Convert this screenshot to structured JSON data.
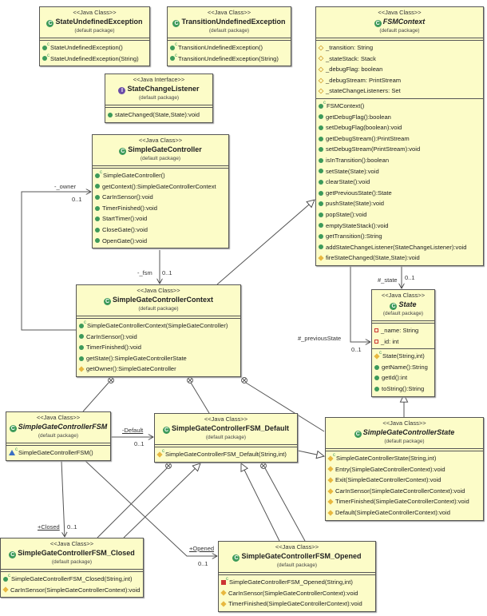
{
  "diagram": {
    "classes": [
      {
        "id": "StateUndefinedException",
        "stereotype": "<<Java Class>>",
        "name": "StateUndefinedException",
        "kind": "class",
        "abstract": false,
        "package": "(default package)",
        "fields": [],
        "methods": [
          {
            "icon": "constructor",
            "text": "StateUndefinedException()"
          },
          {
            "icon": "constructor",
            "text": "StateUndefinedException(String)"
          }
        ]
      },
      {
        "id": "TransitionUndefinedException",
        "stereotype": "<<Java Class>>",
        "name": "TransitionUndefinedException",
        "kind": "class",
        "abstract": false,
        "package": "(default package)",
        "fields": [],
        "methods": [
          {
            "icon": "constructor",
            "text": "TransitionUndefinedException()"
          },
          {
            "icon": "constructor",
            "text": "TransitionUndefinedException(String)"
          }
        ]
      },
      {
        "id": "StateChangeListener",
        "stereotype": "<<Java Interface>>",
        "name": "StateChangeListener",
        "kind": "interface",
        "abstract": false,
        "package": "(default package)",
        "fields": [],
        "methods": [
          {
            "icon": "public",
            "text": "stateChanged(State,State):void"
          }
        ]
      },
      {
        "id": "FSMContext",
        "stereotype": "<<Java Class>>",
        "name": "FSMContext",
        "kind": "class",
        "abstract": true,
        "package": "(default package)",
        "fields": [
          {
            "icon": "field-protected",
            "text": "_transition: String"
          },
          {
            "icon": "field-protected",
            "text": "_stateStack: Stack"
          },
          {
            "icon": "field-protected",
            "text": "_debugFlag: boolean"
          },
          {
            "icon": "field-protected",
            "text": "_debugStream: PrintStream"
          },
          {
            "icon": "field-protected",
            "text": "_stateChangeListeners: Set"
          }
        ],
        "methods": [
          {
            "icon": "constructor",
            "text": "FSMContext()"
          },
          {
            "icon": "public",
            "text": "getDebugFlag():boolean"
          },
          {
            "icon": "public",
            "text": "setDebugFlag(boolean):void"
          },
          {
            "icon": "public",
            "text": "getDebugStream():PrintStream"
          },
          {
            "icon": "public",
            "text": "setDebugStream(PrintStream):void"
          },
          {
            "icon": "public",
            "text": "isInTransition():boolean"
          },
          {
            "icon": "public",
            "text": "setState(State):void"
          },
          {
            "icon": "public",
            "text": "clearState():void"
          },
          {
            "icon": "public",
            "text": "getPreviousState():State"
          },
          {
            "icon": "public",
            "text": "pushState(State):void"
          },
          {
            "icon": "public",
            "text": "popState():void"
          },
          {
            "icon": "public",
            "text": "emptyStateStack():void"
          },
          {
            "icon": "public",
            "text": "getTransition():String"
          },
          {
            "icon": "public",
            "text": "addStateChangeListener(StateChangeListener):void"
          },
          {
            "icon": "protected",
            "text": "fireStateChanged(State,State):void"
          }
        ]
      },
      {
        "id": "SimpleGateController",
        "stereotype": "<<Java Class>>",
        "name": "SimpleGateController",
        "kind": "class",
        "abstract": false,
        "package": "(default package)",
        "fields": [],
        "methods": [
          {
            "icon": "constructor",
            "text": "SimpleGateController()"
          },
          {
            "icon": "public",
            "text": "getContext():SimpleGateControllerContext"
          },
          {
            "icon": "public",
            "text": "CarInSensor():void"
          },
          {
            "icon": "public",
            "text": "TimerFinished():void"
          },
          {
            "icon": "public",
            "text": "StartTimer():void"
          },
          {
            "icon": "public",
            "text": "CloseGate():void"
          },
          {
            "icon": "public",
            "text": "OpenGate():void"
          }
        ]
      },
      {
        "id": "SimpleGateControllerContext",
        "stereotype": "<<Java Class>>",
        "name": "SimpleGateControllerContext",
        "kind": "class",
        "abstract": false,
        "package": "(default package)",
        "fields": [],
        "methods": [
          {
            "icon": "constructor",
            "text": "SimpleGateControllerContext(SimpleGateController)"
          },
          {
            "icon": "public",
            "text": "CarInSensor():void"
          },
          {
            "icon": "public",
            "text": "TimerFinished():void"
          },
          {
            "icon": "public",
            "text": "getState():SimpleGateControllerState"
          },
          {
            "icon": "protected",
            "text": "getOwner():SimpleGateController"
          }
        ]
      },
      {
        "id": "State",
        "stereotype": "<<Java Class>>",
        "name": "State",
        "kind": "class",
        "abstract": true,
        "package": "(default package)",
        "fields": [
          {
            "icon": "private-field",
            "text": "_name: String"
          },
          {
            "icon": "private-field",
            "text": "_id: int"
          }
        ],
        "methods": [
          {
            "icon": "constructor-protected",
            "text": "State(String,int)"
          },
          {
            "icon": "public",
            "text": "getName():String"
          },
          {
            "icon": "public",
            "text": "getId():int"
          },
          {
            "icon": "public",
            "text": "toString():String"
          }
        ]
      },
      {
        "id": "SimpleGateControllerFSM",
        "stereotype": "<<Java Class>>",
        "name": "SimpleGateControllerFSM",
        "kind": "class",
        "abstract": true,
        "package": "(default package)",
        "fields": [],
        "methods": [
          {
            "icon": "constructor-package",
            "text": "SimpleGateControllerFSM()"
          }
        ]
      },
      {
        "id": "SimpleGateControllerFSM_Default",
        "stereotype": "<<Java Class>>",
        "name": "SimpleGateControllerFSM_Default",
        "kind": "class",
        "abstract": false,
        "package": "(default package)",
        "fields": [],
        "methods": [
          {
            "icon": "constructor-protected",
            "text": "SimpleGateControllerFSM_Default(String,int)"
          }
        ]
      },
      {
        "id": "SimpleGateControllerState",
        "stereotype": "<<Java Class>>",
        "name": "SimpleGateControllerState",
        "kind": "class",
        "abstract": true,
        "package": "(default package)",
        "fields": [],
        "methods": [
          {
            "icon": "constructor-protected",
            "text": "SimpleGateControllerState(String,int)"
          },
          {
            "icon": "protected",
            "text": "Entry(SimpleGateControllerContext):void"
          },
          {
            "icon": "protected",
            "text": "Exit(SimpleGateControllerContext):void"
          },
          {
            "icon": "protected",
            "text": "CarInSensor(SimpleGateControllerContext):void"
          },
          {
            "icon": "protected",
            "text": "TimerFinished(SimpleGateControllerContext):void"
          },
          {
            "icon": "protected",
            "text": "Default(SimpleGateControllerContext):void"
          }
        ]
      },
      {
        "id": "SimpleGateControllerFSM_Closed",
        "stereotype": "<<Java Class>>",
        "name": "SimpleGateControllerFSM_Closed",
        "kind": "class",
        "abstract": false,
        "package": "(default package)",
        "fields": [],
        "methods": [
          {
            "icon": "constructor",
            "text": "SimpleGateControllerFSM_Closed(String,int)"
          },
          {
            "icon": "protected",
            "text": "CarInSensor(SimpleGateControllerContext):void"
          }
        ]
      },
      {
        "id": "SimpleGateControllerFSM_Opened",
        "stereotype": "<<Java Class>>",
        "name": "SimpleGateControllerFSM_Opened",
        "kind": "class",
        "abstract": false,
        "package": "(default package)",
        "fields": [],
        "methods": [
          {
            "icon": "constructor-private",
            "text": "SimpleGateControllerFSM_Opened(String,int)"
          },
          {
            "icon": "protected",
            "text": "CarInSensor(SimpleGateControllerContext):void"
          },
          {
            "icon": "protected",
            "text": "TimerFinished(SimpleGateControllerContext):void"
          }
        ]
      }
    ],
    "relations": [
      {
        "type": "association",
        "from": "SimpleGateControllerContext",
        "to": "SimpleGateController",
        "role": "-_owner",
        "multiplicity": "0..1"
      },
      {
        "type": "association",
        "from": "SimpleGateController",
        "to": "SimpleGateControllerContext",
        "role": "-_fsm",
        "multiplicity": "0..1"
      },
      {
        "type": "generalization",
        "from": "SimpleGateControllerContext",
        "to": "FSMContext"
      },
      {
        "type": "association",
        "from": "FSMContext",
        "to": "State",
        "role": "#_state",
        "multiplicity": "0..1"
      },
      {
        "type": "association",
        "from": "FSMContext",
        "to": "State",
        "role": "#_previousState",
        "multiplicity": "0..1"
      },
      {
        "type": "generalization",
        "from": "SimpleGateControllerState",
        "to": "State"
      },
      {
        "type": "nesting",
        "from": "SimpleGateControllerContext",
        "to": "SimpleGateControllerFSM"
      },
      {
        "type": "nesting",
        "from": "SimpleGateControllerContext",
        "to": "SimpleGateControllerFSM_Default"
      },
      {
        "type": "nesting",
        "from": "SimpleGateControllerContext",
        "to": "SimpleGateControllerState"
      },
      {
        "type": "association",
        "from": "SimpleGateControllerFSM",
        "to": "SimpleGateControllerFSM_Default",
        "role": "-Default",
        "multiplicity": "0..1"
      },
      {
        "type": "generalization",
        "from": "SimpleGateControllerFSM_Default",
        "to": "SimpleGateControllerState"
      },
      {
        "type": "association",
        "from": "SimpleGateControllerFSM",
        "to": "SimpleGateControllerFSM_Closed",
        "role": "+Closed",
        "multiplicity": "0..1"
      },
      {
        "type": "association",
        "from": "SimpleGateControllerFSM",
        "to": "SimpleGateControllerFSM_Opened",
        "role": "+Opened",
        "multiplicity": "0..1"
      },
      {
        "type": "nesting",
        "from": "SimpleGateControllerFSM_Default",
        "to": "SimpleGateControllerFSM_Closed"
      },
      {
        "type": "generalization",
        "from": "SimpleGateControllerFSM_Closed",
        "to": "SimpleGateControllerFSM_Default"
      },
      {
        "type": "nesting",
        "from": "SimpleGateControllerFSM_Default",
        "to": "SimpleGateControllerFSM_Opened"
      },
      {
        "type": "generalization",
        "from": "SimpleGateControllerFSM_Opened",
        "to": "SimpleGateControllerFSM_Default"
      }
    ],
    "colors": {
      "box_fill": "#fcfcc8",
      "border": "#555555",
      "public": "#3d9a5a",
      "protected": "#e8b840",
      "private": "#cc3333",
      "interface": "#6a4ca8"
    }
  }
}
